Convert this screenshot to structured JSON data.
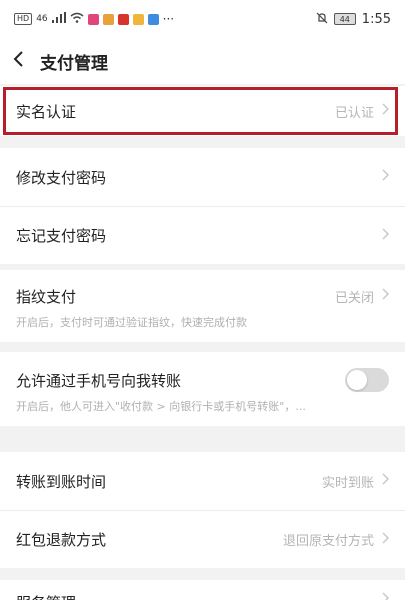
{
  "status_bar": {
    "hd_badge": "HD",
    "signal": "46",
    "battery": "44",
    "time": "1:55"
  },
  "header": {
    "title": "支付管理"
  },
  "section1": {
    "realname_label": "实名认证",
    "realname_status": "已认证"
  },
  "section2": {
    "change_pwd_label": "修改支付密码",
    "forgot_pwd_label": "忘记支付密码"
  },
  "section3": {
    "fingerprint_label": "指纹支付",
    "fingerprint_status": "已关闭",
    "fingerprint_hint": "开启后，支付时可通过验证指纹，快速完成付款"
  },
  "section4": {
    "phone_transfer_label": "允许通过手机号向我转账",
    "phone_transfer_hint": "开启后，他人可进入\"收付款 > 向银行卡或手机号转账\"，...",
    "phone_transfer_enabled": false
  },
  "section5": {
    "arrival_label": "转账到账时间",
    "arrival_value": "实时到账",
    "refund_label": "红包退款方式",
    "refund_value": "退回原支付方式"
  },
  "section6": {
    "service_label": "服务管理"
  },
  "colors": {
    "highlight": "#b51f2a"
  },
  "icons": {
    "back": "chevron-left-icon",
    "chevron": "chevron-right-icon"
  }
}
